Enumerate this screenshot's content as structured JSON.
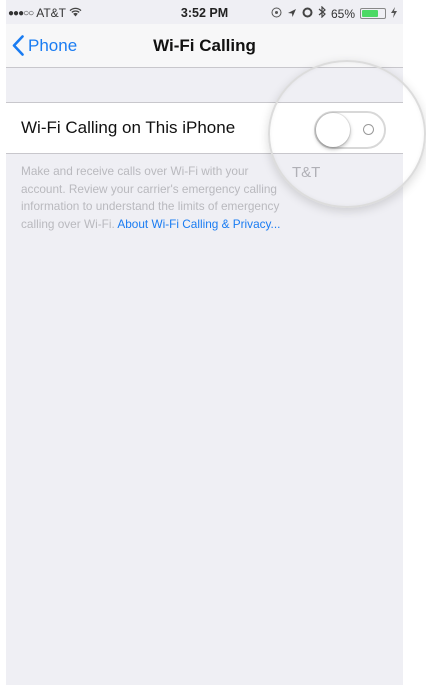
{
  "status_bar": {
    "signal_dots": "●●●○○",
    "carrier": "AT&T",
    "time": "3:52 PM",
    "battery_percent_text": "65%",
    "battery_level": 0.65,
    "icons": [
      "wifi-icon",
      "location-icon",
      "alarm-icon",
      "bluetooth-icon",
      "battery-icon",
      "charging-icon"
    ]
  },
  "nav": {
    "back_label": "Phone",
    "title": "Wi-Fi Calling"
  },
  "settings": {
    "wifi_calling_label": "Wi-Fi Calling on This iPhone",
    "wifi_calling_enabled": false
  },
  "footer": {
    "line1": "Make and receive calls over Wi-Fi with your",
    "line2": "account. Review your carrier's emergency calling",
    "line3": "information to understand the limits of emergency",
    "line4_text": "calling over Wi-Fi. ",
    "link": "About Wi-Fi Calling & Privacy..."
  },
  "magnified_text": "T&T",
  "colors": {
    "accent": "#1a7cf2",
    "background": "#efeff4",
    "battery": "#4cd964"
  }
}
